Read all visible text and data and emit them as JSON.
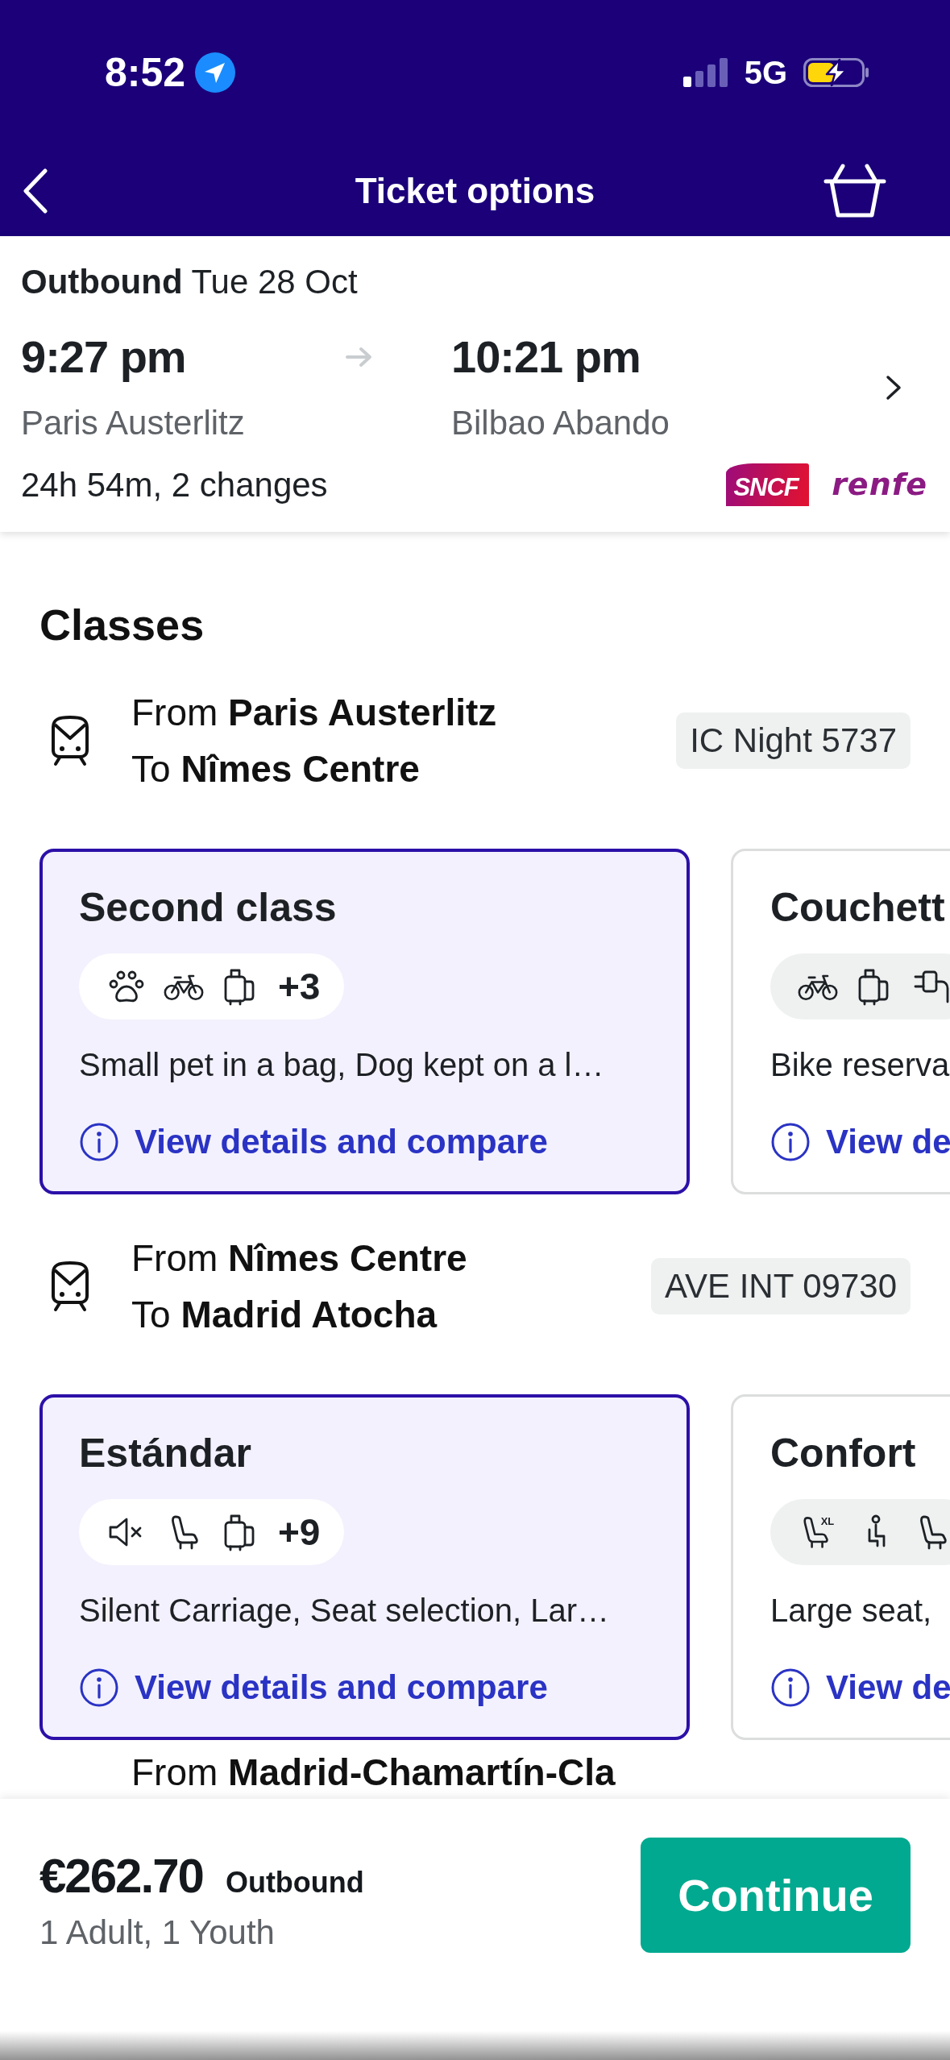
{
  "status_bar": {
    "time": "8:52",
    "network": "5G"
  },
  "header": {
    "title": "Ticket options"
  },
  "journey": {
    "heading": "**Outbound** Tue 28 Oct",
    "departure": {
      "time": "9:27 pm",
      "station": "Paris Austerlitz"
    },
    "arrival": {
      "time": "10:21 pm",
      "station": "Bilbao Abando"
    },
    "summary": "24h 54m, 2 changes",
    "operators": [
      {
        "kind": "sncf",
        "name": "SNCF"
      },
      {
        "kind": "renfe",
        "name": "renfe"
      }
    ]
  },
  "classes": {
    "title": "Classes",
    "segments": [
      {
        "from": "From **Paris Austerlitz**",
        "to": "To **Nîmes Centre**",
        "train": "IC Night 5737",
        "options": [
          {
            "name": "Second class",
            "selected": true,
            "amenities": [
              {
                "kind": "pet"
              },
              {
                "kind": "bike"
              },
              {
                "kind": "luggage"
              }
            ],
            "more": "+3",
            "features": "Small pet in a bag, Dog kept on a l…",
            "link": "View details and compare"
          },
          {
            "name": "Couchett",
            "selected": false,
            "amenities": [
              {
                "kind": "bike"
              },
              {
                "kind": "luggage"
              },
              {
                "kind": "power"
              }
            ],
            "features": "Bike reserva",
            "link": "View de"
          }
        ]
      },
      {
        "from": "From **Nîmes Centre**",
        "to": "To **Madrid Atocha**",
        "train": "AVE INT 09730",
        "options": [
          {
            "name": "Estándar",
            "selected": true,
            "amenities": [
              {
                "kind": "quiet"
              },
              {
                "kind": "seat"
              },
              {
                "kind": "luggage"
              }
            ],
            "more": "+9",
            "features": "Silent Carriage, Seat selection, Lar…",
            "link": "View details and compare"
          },
          {
            "name": "Confort",
            "selected": false,
            "amenities": [
              {
                "kind": "wide_seat",
                "badge": "XL"
              },
              {
                "kind": "seated_person"
              },
              {
                "kind": "seat"
              }
            ],
            "features": "Large seat,",
            "link": "View de"
          }
        ]
      }
    ],
    "next_segment": {
      "from": "From **Madrid-Chamartín-Cla**"
    }
  },
  "footer": {
    "price": "€262.70",
    "direction": "Outbound",
    "passengers": "1 Adult, 1 Youth",
    "button": "Continue"
  }
}
